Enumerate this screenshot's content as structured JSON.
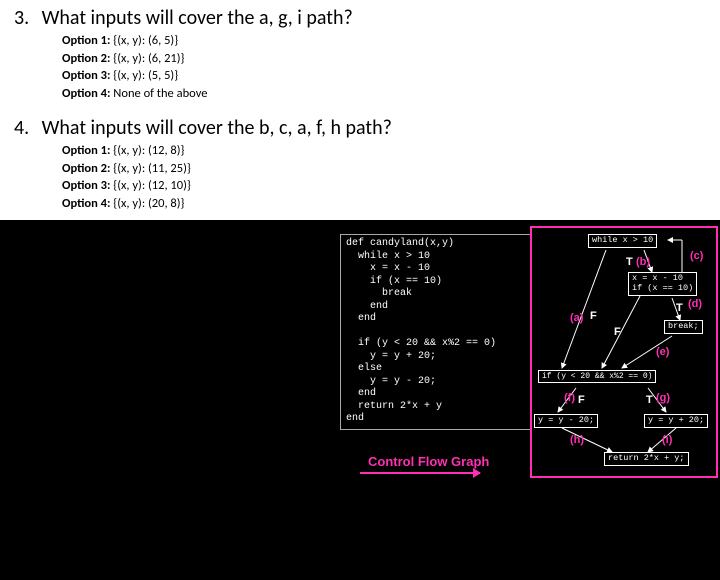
{
  "q3": {
    "number": "3.",
    "text": "What inputs will cover the a, g, i path?",
    "options": [
      {
        "label": "Option 1:",
        "value": "{(x, y): (6, 5)}"
      },
      {
        "label": "Option 2:",
        "value": "{(x, y): (6, 21)}"
      },
      {
        "label": "Option 3:",
        "value": "{(x, y): (5, 5)}"
      },
      {
        "label": "Option 4:",
        "value": "None of the above"
      }
    ]
  },
  "q4": {
    "number": "4.",
    "text": "What inputs will cover the b, c, a, f, h path?",
    "options": [
      {
        "label": "Option 1:",
        "value": "{(x, y): (12, 8)}"
      },
      {
        "label": "Option 2:",
        "value": "{(x, y): (11, 25)}"
      },
      {
        "label": "Option 3:",
        "value": "{(x, y): (12, 10)}"
      },
      {
        "label": "Option 4:",
        "value": "{(x, y): (20, 8)}"
      }
    ]
  },
  "code": "def candyland(x,y)\n  while x > 10\n    x = x - 10\n    if (x == 10)\n      break\n    end\n  end\n\n  if (y < 20 && x%2 == 0)\n    y = y + 20;\n  else\n    y = y - 20;\n  end\n  return 2*x + y\nend",
  "nodes": {
    "n1": "while x > 10",
    "n2": "x = x - 10\nif (x == 10)",
    "n3": "break;",
    "n4": "if (y < 20 && x%2 == 0)",
    "n5": "y = y - 20;",
    "n6": "y = y + 20;",
    "n7": "return 2*x + y;"
  },
  "labels": {
    "a": "(a)",
    "b": "(b)",
    "c": "(c)",
    "d": "(d)",
    "e": "(e)",
    "f": "(f)",
    "g": "(g)",
    "h": "(h)",
    "i": "(i)",
    "T": "T",
    "F": "F"
  },
  "cfg": "Control Flow Graph"
}
